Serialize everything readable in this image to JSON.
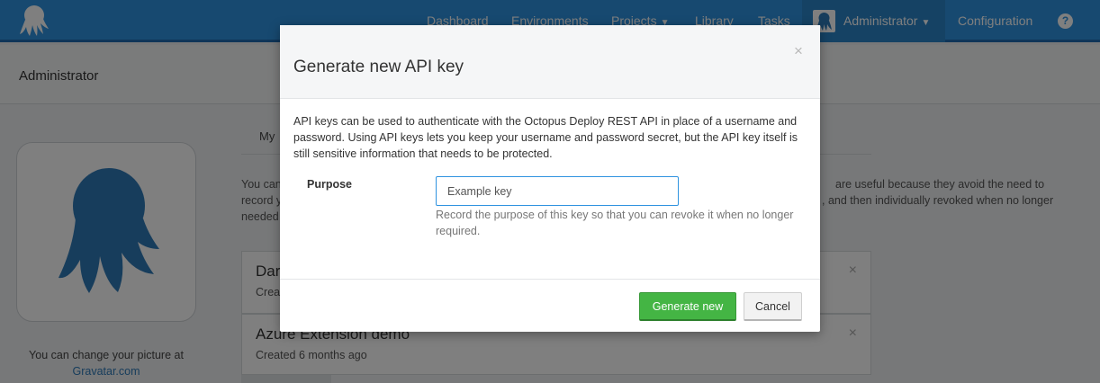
{
  "nav": {
    "items": [
      "Dashboard",
      "Environments",
      "Projects",
      "Library",
      "Tasks"
    ],
    "user_label": "Administrator",
    "configuration_label": "Configuration",
    "help_glyph": "?",
    "logo_icon": "octopus-logo-icon"
  },
  "header": {
    "title": "Administrator"
  },
  "profile": {
    "gravatar_text": "You can change your picture at",
    "gravatar_link": "Gravatar.com"
  },
  "main": {
    "tab_label": "My",
    "intro_left": "You can",
    "intro_right": "are useful because they avoid the need to",
    "intro_line2_left": "record y",
    "intro_line2_right": ", and then individually revoked when no longer",
    "intro_line3_left": "needed",
    "keys": [
      {
        "name": "Dar",
        "created": "Crea"
      },
      {
        "name": "Azure Extension demo",
        "created": "Created 6 months ago"
      }
    ]
  },
  "modal": {
    "title": "Generate new API key",
    "close_glyph": "×",
    "description": "API keys can be used to authenticate with the Octopus Deploy REST API in place of a username and password. Using API keys lets you keep your username and password secret, but the API key itself is still sensitive information that needs to be protected.",
    "purpose_label": "Purpose",
    "purpose_value": "Example key",
    "purpose_help": "Record the purpose of this key so that you can revoke it when no longer required.",
    "generate_label": "Generate new",
    "cancel_label": "Cancel"
  },
  "colors": {
    "nav_bg": "#2f93e0",
    "accent_green": "#44b544",
    "octo_blue": "#2f7ab8"
  }
}
